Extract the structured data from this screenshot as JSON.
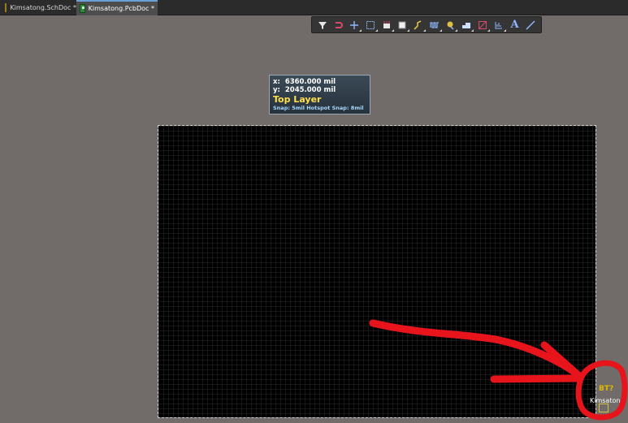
{
  "tabs": [
    {
      "label": "Kimsatong.SchDoc *",
      "icon": "schematic-doc-icon",
      "active": false
    },
    {
      "label": "Kimsatong.PcbDoc *",
      "icon": "pcb-doc-icon",
      "active": true
    }
  ],
  "toolbar": {
    "tools": [
      {
        "name": "filter-tool",
        "icon": "filter-icon"
      },
      {
        "name": "interactive-routing-tool",
        "icon": "magnet-route-icon"
      },
      {
        "name": "place-tool",
        "icon": "crosshair-icon"
      },
      {
        "name": "select-tool",
        "icon": "select-rect-icon"
      },
      {
        "name": "component-tool",
        "icon": "component-icon"
      },
      {
        "name": "region-tool",
        "icon": "region-icon"
      },
      {
        "name": "route-tool",
        "icon": "route-icon"
      },
      {
        "name": "length-tune-tool",
        "icon": "tune-icon"
      },
      {
        "name": "via-tool",
        "icon": "via-icon"
      },
      {
        "name": "polygon-tool",
        "icon": "polygon-icon"
      },
      {
        "name": "keepout-tool",
        "icon": "keepout-icon"
      },
      {
        "name": "dimension-tool",
        "icon": "dimension-icon"
      },
      {
        "name": "text-tool",
        "icon": "text-icon"
      },
      {
        "name": "line-tool",
        "icon": "line-icon"
      }
    ]
  },
  "hud": {
    "x_label": "x:",
    "x_value": "6360.000 mil",
    "y_label": "y:",
    "y_value": "2045.000 mil",
    "layer": "Top Layer",
    "snap": "Snap: 5mil Hotspot Snap: 8mil"
  },
  "component": {
    "designator": "BT?",
    "comment": "Kimsatong"
  },
  "colors": {
    "canvas": "#716c6a",
    "board": "#000000",
    "layer_text": "#ffe04a",
    "annotation": "#e8141c"
  }
}
